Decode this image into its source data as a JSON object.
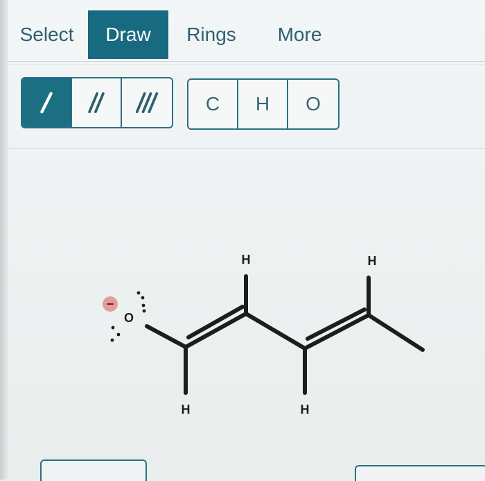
{
  "menu": {
    "tabs": [
      {
        "label": "Select",
        "active": false
      },
      {
        "label": "Draw",
        "active": true
      },
      {
        "label": "Rings",
        "active": false
      },
      {
        "label": "More",
        "active": false
      }
    ]
  },
  "toolbar": {
    "bond_tools": [
      {
        "icon": "single-bond-icon",
        "active": true
      },
      {
        "icon": "double-bond-icon",
        "active": false
      },
      {
        "icon": "triple-bond-icon",
        "active": false
      }
    ],
    "atom_tools": [
      {
        "label": "C"
      },
      {
        "label": "H"
      },
      {
        "label": "O"
      }
    ]
  },
  "molecule": {
    "oxygen_label": "O",
    "charge_label": "−",
    "hydrogen_labels": [
      "H",
      "H",
      "H",
      "H"
    ]
  },
  "colors": {
    "accent": "#176a7f",
    "charge": "#e89a95",
    "bond": "#1d1d1d"
  }
}
